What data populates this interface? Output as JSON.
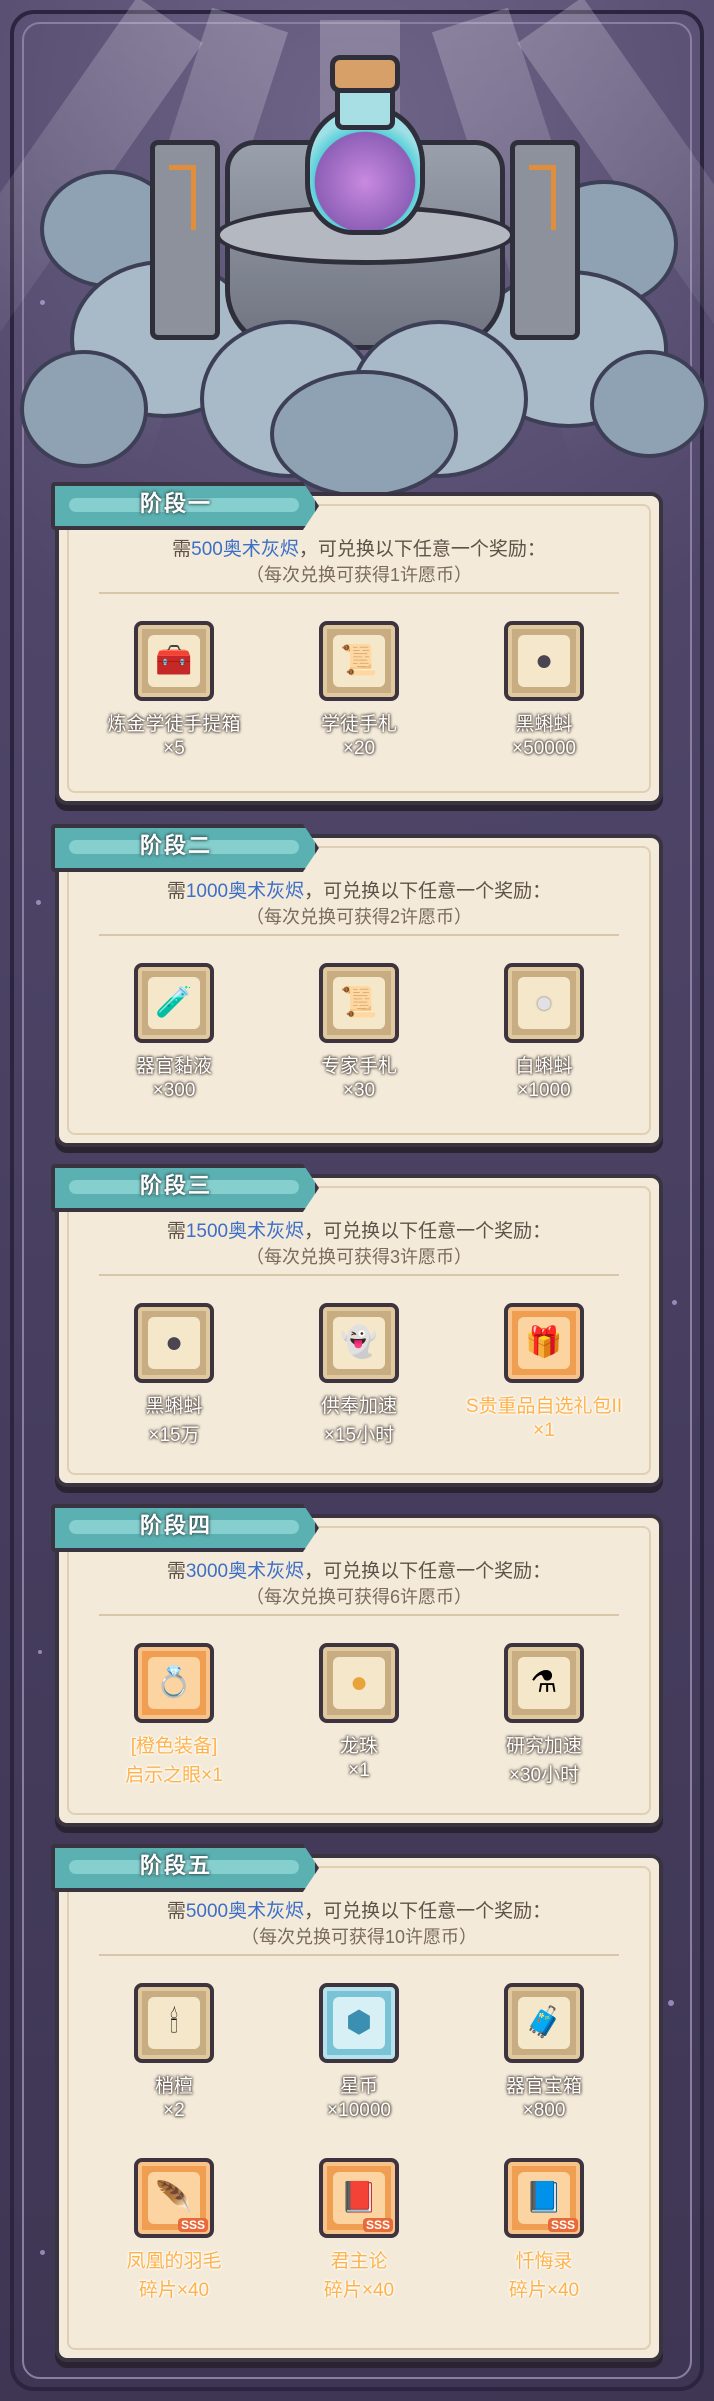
{
  "colors": {
    "background": "#463d5e",
    "panel": "#f3ead9",
    "tag": "#5bb1b2",
    "highlight": "#3d6fc7",
    "orange_text": "#ffb24a"
  },
  "stages": [
    {
      "label": "阶段一",
      "req_prefix": "需",
      "req_amount": "500奥术灰烬",
      "req_suffix": "，可兑换以下任意一个奖励：",
      "sub": "（每次兑换可获得1许愿币）",
      "items": [
        {
          "icon": "toolbox-icon",
          "name": "炼金学徒手提箱",
          "qty": "×5"
        },
        {
          "icon": "scroll-icon",
          "name": "学徒手札",
          "qty": "×20"
        },
        {
          "icon": "black-tadpole-icon",
          "name": "黑蝌蚪",
          "qty": "×50000"
        }
      ]
    },
    {
      "label": "阶段二",
      "req_prefix": "需",
      "req_amount": "1000奥术灰烬",
      "req_suffix": "，可兑换以下任意一个奖励：",
      "sub": "（每次兑换可获得2许愿币）",
      "items": [
        {
          "icon": "organ-slime-icon",
          "name": "器官黏液",
          "qty": "×300"
        },
        {
          "icon": "expert-scroll-icon",
          "name": "专家手札",
          "qty": "×30"
        },
        {
          "icon": "white-tadpole-icon",
          "name": "白蝌蚪",
          "qty": "×1000"
        }
      ]
    },
    {
      "label": "阶段三",
      "req_prefix": "需",
      "req_amount": "1500奥术灰烬",
      "req_suffix": "，可兑换以下任意一个奖励：",
      "sub": "（每次兑换可获得3许愿币）",
      "items": [
        {
          "icon": "black-tadpole-icon",
          "name": "黑蝌蚪",
          "qty": "×15万"
        },
        {
          "icon": "ghost-speedup-icon",
          "name": "供奉加速",
          "qty": "×15小时"
        },
        {
          "icon": "gift-pack-icon",
          "name": "S贵重品自选礼包II",
          "qty": "×1",
          "highlight": true
        }
      ]
    },
    {
      "label": "阶段四",
      "req_prefix": "需",
      "req_amount": "3000奥术灰烬",
      "req_suffix": "，可兑换以下任意一个奖励：",
      "sub": "（每次兑换可获得6许愿币）",
      "items": [
        {
          "icon": "ring-icon",
          "name": "[橙色装备]",
          "qty": "启示之眼×1",
          "highlight": true
        },
        {
          "icon": "dragon-pearl-icon",
          "name": "龙珠",
          "qty": "×1"
        },
        {
          "icon": "research-speedup-icon",
          "name": "研究加速",
          "qty": "×30小时"
        }
      ]
    },
    {
      "label": "阶段五",
      "req_prefix": "需",
      "req_amount": "5000奥术灰烬",
      "req_suffix": "，可兑换以下任意一个奖励：",
      "sub": "（每次兑换可获得10许愿币）",
      "items": [
        {
          "icon": "incense-icon",
          "name": "梢檀",
          "qty": "×2"
        },
        {
          "icon": "star-coin-icon",
          "name": "星币",
          "qty": "×10000"
        },
        {
          "icon": "organ-chest-icon",
          "name": "器官宝箱",
          "qty": "×800"
        },
        {
          "icon": "phoenix-feather-icon",
          "name": "凤凰的羽毛",
          "qty": "碎片×40",
          "highlight": true
        },
        {
          "icon": "book-icon",
          "name": "君主论",
          "qty": "碎片×40",
          "highlight": true
        },
        {
          "icon": "confession-icon",
          "name": "忏悔录",
          "qty": "碎片×40",
          "highlight": true
        }
      ]
    }
  ]
}
